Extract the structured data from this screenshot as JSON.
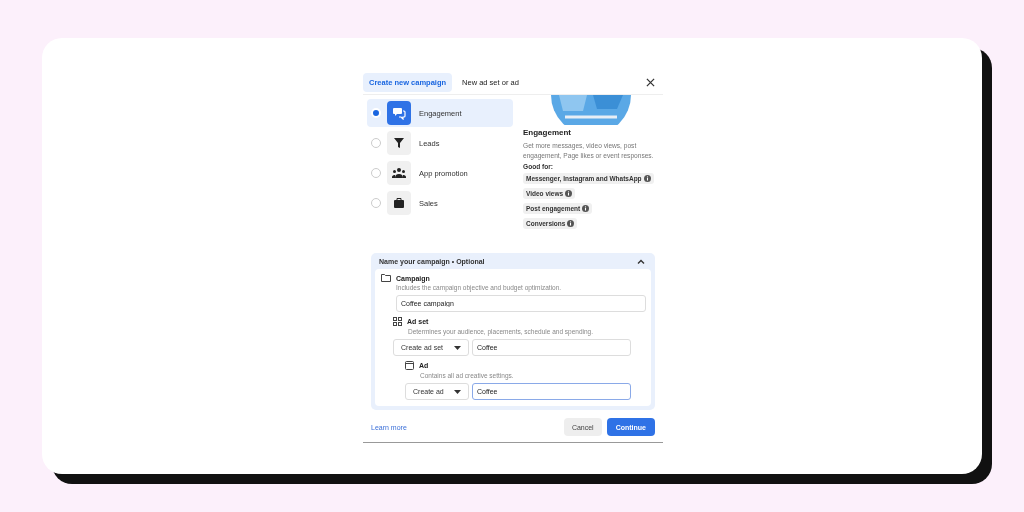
{
  "tabs": [
    {
      "label": "Create new campaign",
      "selected": true
    },
    {
      "label": "New ad set or ad",
      "selected": false
    }
  ],
  "objectives": [
    {
      "label": "Engagement",
      "selected": true
    },
    {
      "label": "Leads",
      "selected": false
    },
    {
      "label": "App promotion",
      "selected": false
    },
    {
      "label": "Sales",
      "selected": false
    }
  ],
  "detail": {
    "title": "Engagement",
    "description": "Get more messages, video views, post engagement, Page likes or event responses.",
    "good_for_label": "Good for:",
    "good_for": [
      "Messenger, Instagram and WhatsApp",
      "Video views",
      "Post engagement",
      "Conversions"
    ]
  },
  "naming": {
    "title": "Name your campaign • Optional",
    "expanded": true,
    "campaign": {
      "label": "Campaign",
      "hint": "Includes the campaign objective and budget optimization.",
      "value": "Coffee campaign"
    },
    "ad_set": {
      "label": "Ad set",
      "hint": "Determines your audience, placements, schedule and spending.",
      "select": "Create ad set",
      "value": "Coffee"
    },
    "ad": {
      "label": "Ad",
      "hint": "Contains all ad creative settings.",
      "select": "Create ad",
      "value": "Coffee"
    }
  },
  "footer": {
    "link": "Learn more",
    "buttons": [
      "Cancel",
      "Continue"
    ]
  }
}
